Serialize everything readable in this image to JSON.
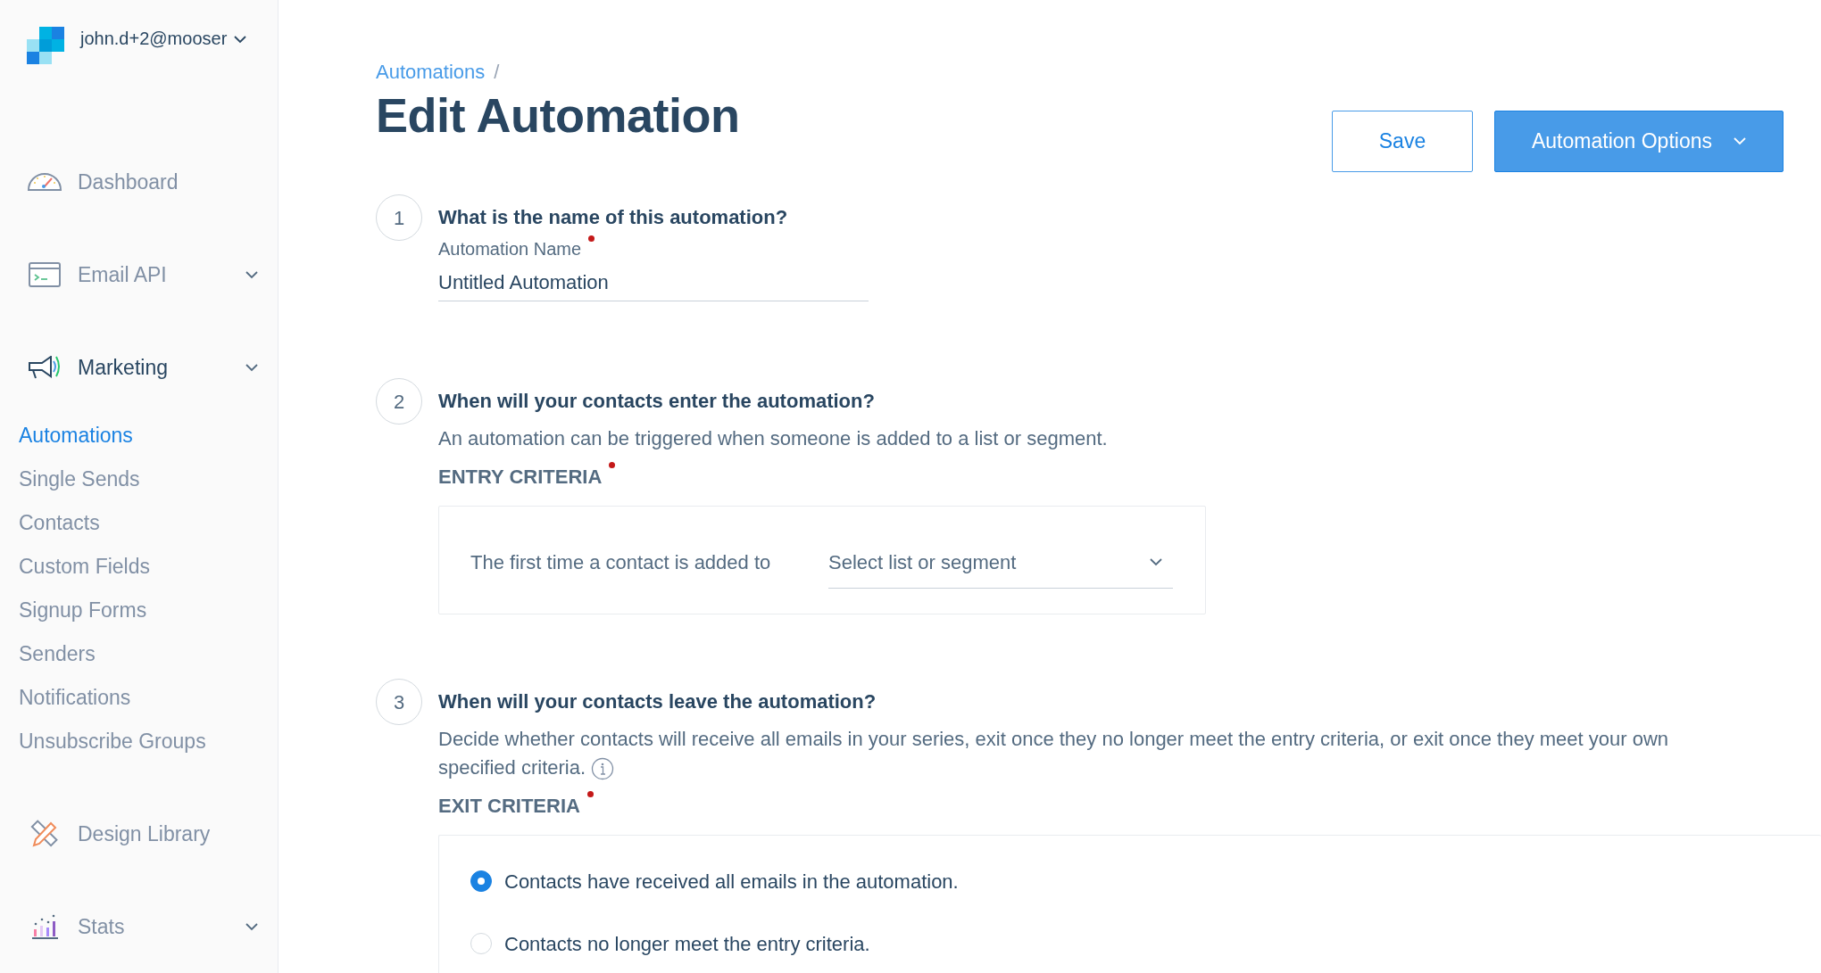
{
  "account": {
    "email": "john.d+2@mooser",
    "has_menu": true
  },
  "sidebar": {
    "items": [
      {
        "label": "Dashboard",
        "has_menu": false
      },
      {
        "label": "Email API",
        "has_menu": true
      },
      {
        "label": "Marketing",
        "has_menu": true,
        "children": [
          {
            "label": "Automations",
            "selected": true
          },
          {
            "label": "Single Sends",
            "selected": false
          },
          {
            "label": "Contacts",
            "selected": false
          },
          {
            "label": "Custom Fields",
            "selected": false
          },
          {
            "label": "Signup Forms",
            "selected": false
          },
          {
            "label": "Senders",
            "selected": false
          },
          {
            "label": "Notifications",
            "selected": false
          },
          {
            "label": "Unsubscribe Groups",
            "selected": false
          }
        ]
      },
      {
        "label": "Design Library",
        "has_menu": false
      },
      {
        "label": "Stats",
        "has_menu": true
      }
    ]
  },
  "breadcrumb": [
    {
      "label": "Automations",
      "separator": "/"
    }
  ],
  "title": "Edit Automation",
  "buttons": [
    {
      "label": "Save",
      "kind": "outline"
    },
    {
      "label": "Automation Options",
      "kind": "primary",
      "has_menu": true
    }
  ],
  "steps": [
    {
      "number": "1",
      "question": "What is the name of this automation?",
      "kind": "name",
      "field": {
        "label": "Automation Name",
        "required": true,
        "value": "Untitled Automation"
      }
    },
    {
      "number": "2",
      "question": "When will your contacts enter the automation?",
      "kind": "entry",
      "description": "An automation can be triggered when someone is added to a list or segment.",
      "section_label": "ENTRY CRITERIA",
      "required": true,
      "prompt": "The first time a contact is added to",
      "select": {
        "placeholder": "Select list or segment"
      }
    },
    {
      "number": "3",
      "question": "When will your contacts leave the automation?",
      "kind": "exit",
      "description": "Decide whether contacts will receive all emails in your series, exit once they no longer meet the entry criteria, or exit once they meet your own specified criteria.",
      "info": true,
      "section_label": "EXIT CRITERIA",
      "required": true,
      "options": [
        {
          "label": "Contacts have received all emails in the automation.",
          "selected": true
        },
        {
          "label": "Contacts no longer meet the entry criteria.",
          "selected": false
        }
      ]
    }
  ]
}
